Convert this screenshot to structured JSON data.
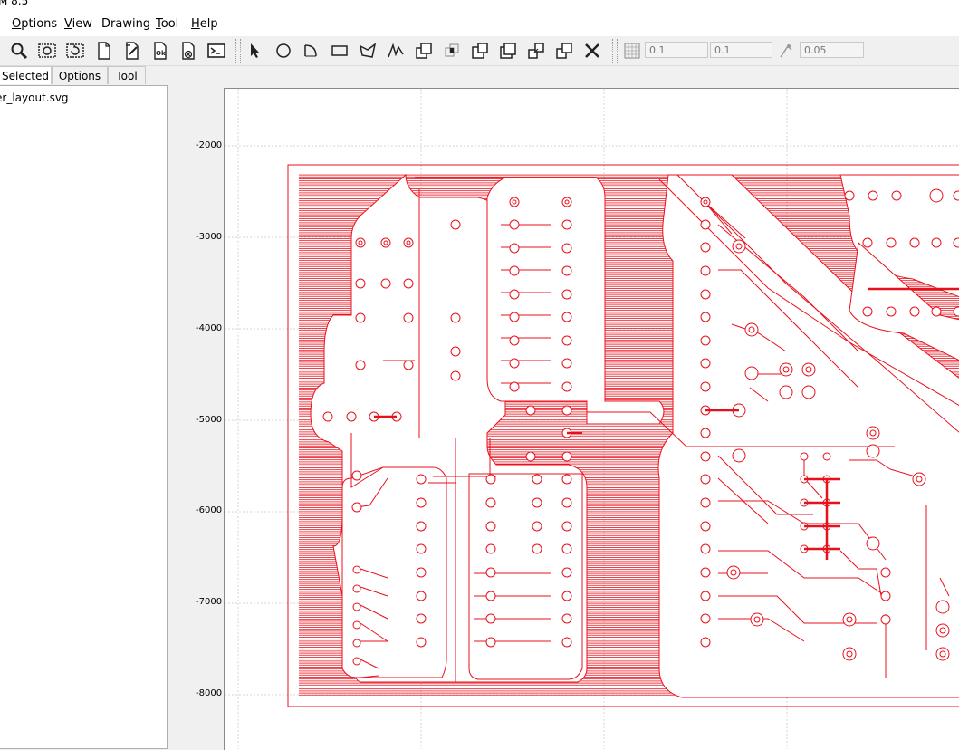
{
  "window": {
    "title_fragment": "M 8.5"
  },
  "menu": [
    {
      "label": "Options",
      "ul": "O",
      "rest": "ptions"
    },
    {
      "label": "View",
      "ul": "V",
      "rest": "iew"
    },
    {
      "label": "Drawing",
      "ul": "",
      "rest": "Drawing"
    },
    {
      "label": "Tool",
      "ul": "T",
      "rest": "ool"
    },
    {
      "label": "Help",
      "ul": "H",
      "rest": "elp"
    }
  ],
  "toolbar": {
    "icons": [
      "zoom-icon",
      "zoom-fit-icon",
      "refresh-icon",
      "new-file-icon",
      "edit-file-icon",
      "ok-file-icon",
      "close-file-icon",
      "shell-icon",
      "pointer-icon",
      "circle-icon",
      "arc-icon",
      "rectangle-icon",
      "polygon-icon",
      "path-icon",
      "union-icon",
      "intersect-icon",
      "subtract-icon",
      "exclude-icon",
      "move-icon",
      "copy-icon",
      "delete-icon"
    ],
    "grid_x": "0.1",
    "grid_y": "0.1",
    "snap": "0.05"
  },
  "side_tabs": [
    "Selected",
    "Options",
    "Tool"
  ],
  "project_tree": {
    "file": "er_layout.svg"
  },
  "y_axis_labels": [
    "-2000",
    "-3000",
    "-4000",
    "-5000",
    "-6000",
    "-7000",
    "-8000"
  ],
  "colors": {
    "trace": "#e8101c",
    "grid": "#cfcfcf"
  }
}
